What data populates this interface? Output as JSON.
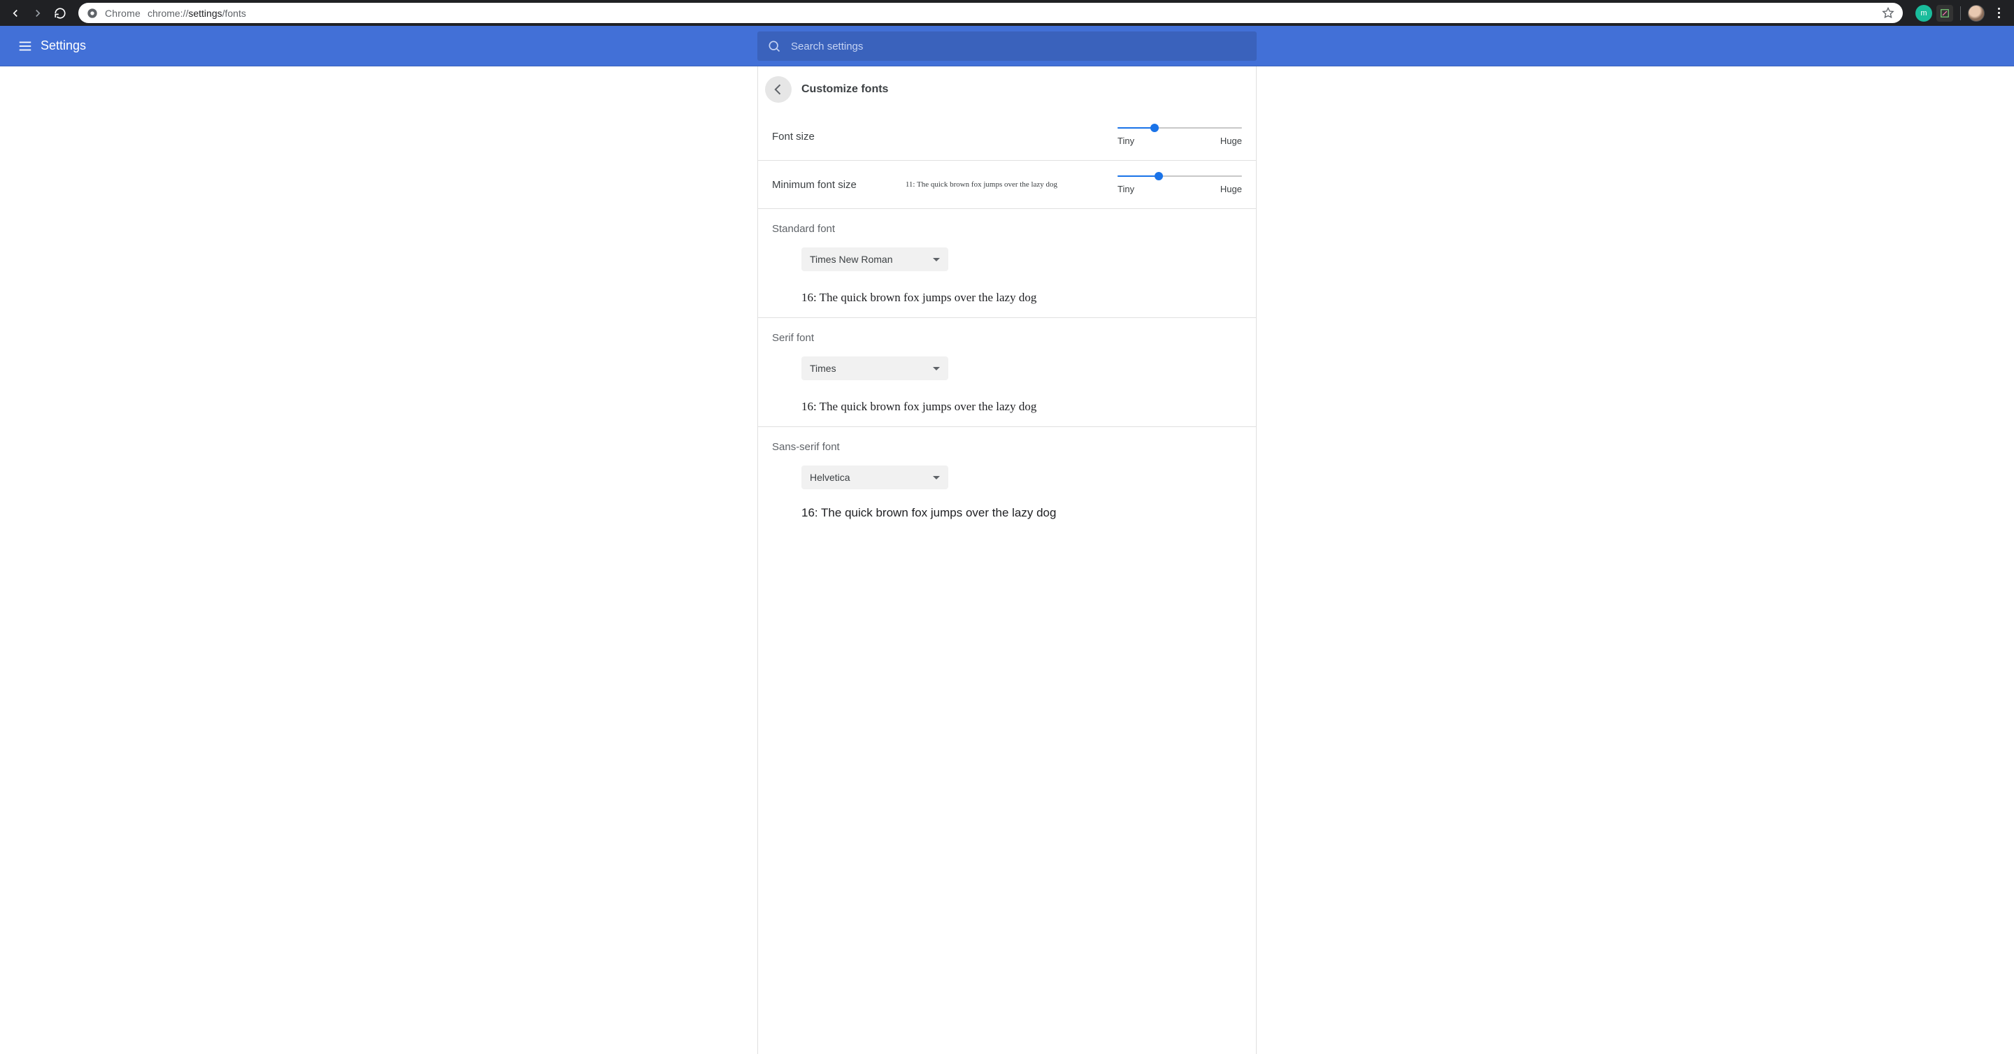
{
  "browser": {
    "origin_label": "Chrome",
    "url_prefix": "chrome://",
    "url_strong": "settings",
    "url_suffix": "/fonts"
  },
  "header": {
    "title": "Settings",
    "search_placeholder": "Search settings"
  },
  "page": {
    "title": "Customize fonts",
    "font_size": {
      "label": "Font size",
      "min_label": "Tiny",
      "max_label": "Huge",
      "percent": 30
    },
    "min_font_size": {
      "label": "Minimum font size",
      "preview": "11: The quick brown fox jumps over the lazy dog",
      "min_label": "Tiny",
      "max_label": "Huge",
      "percent": 33
    },
    "standard_font": {
      "title": "Standard font",
      "selected": "Times New Roman",
      "preview": "16: The quick brown fox jumps over the lazy dog"
    },
    "serif_font": {
      "title": "Serif font",
      "selected": "Times",
      "preview": "16: The quick brown fox jumps over the lazy dog"
    },
    "sans_serif_font": {
      "title": "Sans-serif font",
      "selected": "Helvetica",
      "preview": "16: The quick brown fox jumps over the lazy dog"
    }
  }
}
